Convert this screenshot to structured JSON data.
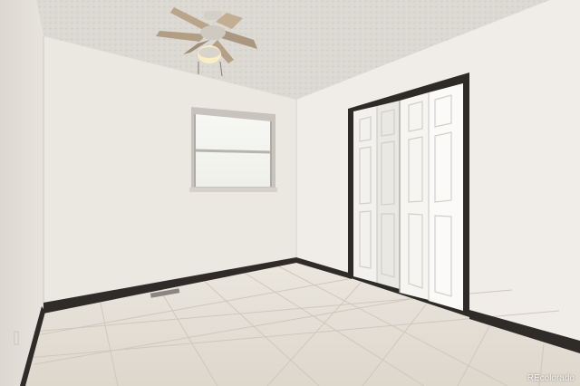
{
  "watermark": "REcolorado",
  "colors": {
    "ceiling": "#dcd8d2",
    "left_wall": "#e6e2dc",
    "back_wall": "#ebe7e1",
    "right_wall": "#f0ede9",
    "floor": "#e4dfd6",
    "grout": "#cfc8bc",
    "baseboard": "#2f2b28",
    "door_frame": "#2e2a27",
    "closet_door": "#f6f5f2",
    "window_sky": "#f4f6f2"
  }
}
